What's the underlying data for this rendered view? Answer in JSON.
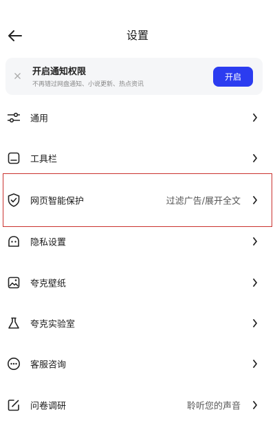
{
  "header": {
    "title": "设置",
    "back_icon": "arrow-left-icon"
  },
  "notice": {
    "title": "开启通知权限",
    "subtitle": "不再错过网盘通知、小说更新、热点资讯",
    "button_label": "开启",
    "accent": "#2b3cf0"
  },
  "settings": [
    {
      "label": "通用",
      "icon": "sliders-icon",
      "value": ""
    },
    {
      "label": "工具栏",
      "icon": "toolbar-icon",
      "value": ""
    },
    {
      "label": "网页智能保护",
      "icon": "shield-check-icon",
      "value": "过滤广告/展开全文"
    },
    {
      "label": "隐私设置",
      "icon": "privacy-icon",
      "value": ""
    },
    {
      "label": "夸克壁纸",
      "icon": "wallpaper-icon",
      "value": ""
    },
    {
      "label": "夸克实验室",
      "icon": "flask-icon",
      "value": ""
    },
    {
      "label": "客服咨询",
      "icon": "chat-icon",
      "value": ""
    },
    {
      "label": "问卷调研",
      "icon": "survey-edit-icon",
      "value": "聆听您的声音"
    }
  ],
  "highlight_color": "#c9302c"
}
